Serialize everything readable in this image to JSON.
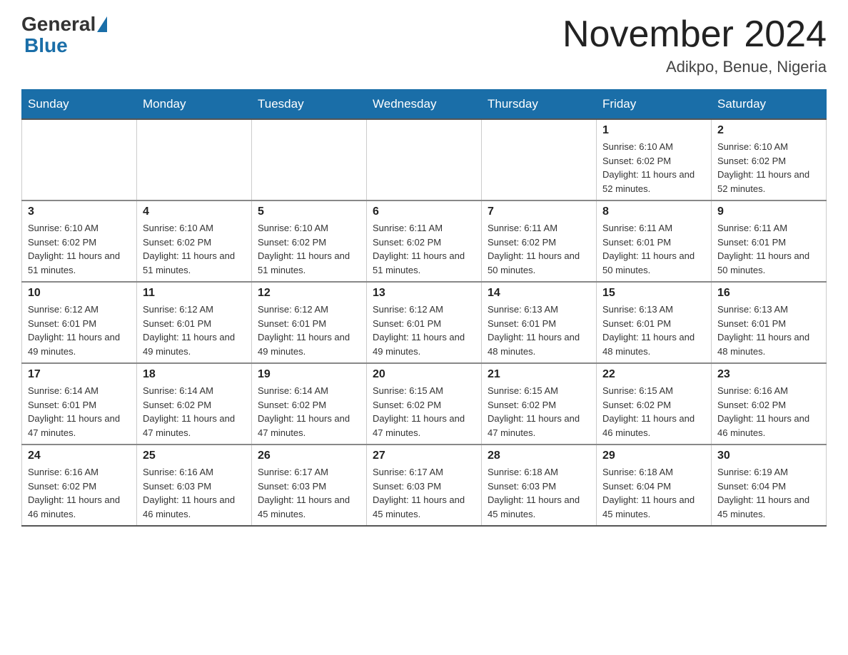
{
  "header": {
    "logo_general": "General",
    "logo_blue": "Blue",
    "title": "November 2024",
    "subtitle": "Adikpo, Benue, Nigeria"
  },
  "days_of_week": [
    "Sunday",
    "Monday",
    "Tuesday",
    "Wednesday",
    "Thursday",
    "Friday",
    "Saturday"
  ],
  "weeks": [
    [
      {
        "num": "",
        "sunrise": "",
        "sunset": "",
        "daylight": "",
        "empty": true
      },
      {
        "num": "",
        "sunrise": "",
        "sunset": "",
        "daylight": "",
        "empty": true
      },
      {
        "num": "",
        "sunrise": "",
        "sunset": "",
        "daylight": "",
        "empty": true
      },
      {
        "num": "",
        "sunrise": "",
        "sunset": "",
        "daylight": "",
        "empty": true
      },
      {
        "num": "",
        "sunrise": "",
        "sunset": "",
        "daylight": "",
        "empty": true
      },
      {
        "num": "1",
        "sunrise": "Sunrise: 6:10 AM",
        "sunset": "Sunset: 6:02 PM",
        "daylight": "Daylight: 11 hours and 52 minutes.",
        "empty": false
      },
      {
        "num": "2",
        "sunrise": "Sunrise: 6:10 AM",
        "sunset": "Sunset: 6:02 PM",
        "daylight": "Daylight: 11 hours and 52 minutes.",
        "empty": false
      }
    ],
    [
      {
        "num": "3",
        "sunrise": "Sunrise: 6:10 AM",
        "sunset": "Sunset: 6:02 PM",
        "daylight": "Daylight: 11 hours and 51 minutes.",
        "empty": false
      },
      {
        "num": "4",
        "sunrise": "Sunrise: 6:10 AM",
        "sunset": "Sunset: 6:02 PM",
        "daylight": "Daylight: 11 hours and 51 minutes.",
        "empty": false
      },
      {
        "num": "5",
        "sunrise": "Sunrise: 6:10 AM",
        "sunset": "Sunset: 6:02 PM",
        "daylight": "Daylight: 11 hours and 51 minutes.",
        "empty": false
      },
      {
        "num": "6",
        "sunrise": "Sunrise: 6:11 AM",
        "sunset": "Sunset: 6:02 PM",
        "daylight": "Daylight: 11 hours and 51 minutes.",
        "empty": false
      },
      {
        "num": "7",
        "sunrise": "Sunrise: 6:11 AM",
        "sunset": "Sunset: 6:02 PM",
        "daylight": "Daylight: 11 hours and 50 minutes.",
        "empty": false
      },
      {
        "num": "8",
        "sunrise": "Sunrise: 6:11 AM",
        "sunset": "Sunset: 6:01 PM",
        "daylight": "Daylight: 11 hours and 50 minutes.",
        "empty": false
      },
      {
        "num": "9",
        "sunrise": "Sunrise: 6:11 AM",
        "sunset": "Sunset: 6:01 PM",
        "daylight": "Daylight: 11 hours and 50 minutes.",
        "empty": false
      }
    ],
    [
      {
        "num": "10",
        "sunrise": "Sunrise: 6:12 AM",
        "sunset": "Sunset: 6:01 PM",
        "daylight": "Daylight: 11 hours and 49 minutes.",
        "empty": false
      },
      {
        "num": "11",
        "sunrise": "Sunrise: 6:12 AM",
        "sunset": "Sunset: 6:01 PM",
        "daylight": "Daylight: 11 hours and 49 minutes.",
        "empty": false
      },
      {
        "num": "12",
        "sunrise": "Sunrise: 6:12 AM",
        "sunset": "Sunset: 6:01 PM",
        "daylight": "Daylight: 11 hours and 49 minutes.",
        "empty": false
      },
      {
        "num": "13",
        "sunrise": "Sunrise: 6:12 AM",
        "sunset": "Sunset: 6:01 PM",
        "daylight": "Daylight: 11 hours and 49 minutes.",
        "empty": false
      },
      {
        "num": "14",
        "sunrise": "Sunrise: 6:13 AM",
        "sunset": "Sunset: 6:01 PM",
        "daylight": "Daylight: 11 hours and 48 minutes.",
        "empty": false
      },
      {
        "num": "15",
        "sunrise": "Sunrise: 6:13 AM",
        "sunset": "Sunset: 6:01 PM",
        "daylight": "Daylight: 11 hours and 48 minutes.",
        "empty": false
      },
      {
        "num": "16",
        "sunrise": "Sunrise: 6:13 AM",
        "sunset": "Sunset: 6:01 PM",
        "daylight": "Daylight: 11 hours and 48 minutes.",
        "empty": false
      }
    ],
    [
      {
        "num": "17",
        "sunrise": "Sunrise: 6:14 AM",
        "sunset": "Sunset: 6:01 PM",
        "daylight": "Daylight: 11 hours and 47 minutes.",
        "empty": false
      },
      {
        "num": "18",
        "sunrise": "Sunrise: 6:14 AM",
        "sunset": "Sunset: 6:02 PM",
        "daylight": "Daylight: 11 hours and 47 minutes.",
        "empty": false
      },
      {
        "num": "19",
        "sunrise": "Sunrise: 6:14 AM",
        "sunset": "Sunset: 6:02 PM",
        "daylight": "Daylight: 11 hours and 47 minutes.",
        "empty": false
      },
      {
        "num": "20",
        "sunrise": "Sunrise: 6:15 AM",
        "sunset": "Sunset: 6:02 PM",
        "daylight": "Daylight: 11 hours and 47 minutes.",
        "empty": false
      },
      {
        "num": "21",
        "sunrise": "Sunrise: 6:15 AM",
        "sunset": "Sunset: 6:02 PM",
        "daylight": "Daylight: 11 hours and 47 minutes.",
        "empty": false
      },
      {
        "num": "22",
        "sunrise": "Sunrise: 6:15 AM",
        "sunset": "Sunset: 6:02 PM",
        "daylight": "Daylight: 11 hours and 46 minutes.",
        "empty": false
      },
      {
        "num": "23",
        "sunrise": "Sunrise: 6:16 AM",
        "sunset": "Sunset: 6:02 PM",
        "daylight": "Daylight: 11 hours and 46 minutes.",
        "empty": false
      }
    ],
    [
      {
        "num": "24",
        "sunrise": "Sunrise: 6:16 AM",
        "sunset": "Sunset: 6:02 PM",
        "daylight": "Daylight: 11 hours and 46 minutes.",
        "empty": false
      },
      {
        "num": "25",
        "sunrise": "Sunrise: 6:16 AM",
        "sunset": "Sunset: 6:03 PM",
        "daylight": "Daylight: 11 hours and 46 minutes.",
        "empty": false
      },
      {
        "num": "26",
        "sunrise": "Sunrise: 6:17 AM",
        "sunset": "Sunset: 6:03 PM",
        "daylight": "Daylight: 11 hours and 45 minutes.",
        "empty": false
      },
      {
        "num": "27",
        "sunrise": "Sunrise: 6:17 AM",
        "sunset": "Sunset: 6:03 PM",
        "daylight": "Daylight: 11 hours and 45 minutes.",
        "empty": false
      },
      {
        "num": "28",
        "sunrise": "Sunrise: 6:18 AM",
        "sunset": "Sunset: 6:03 PM",
        "daylight": "Daylight: 11 hours and 45 minutes.",
        "empty": false
      },
      {
        "num": "29",
        "sunrise": "Sunrise: 6:18 AM",
        "sunset": "Sunset: 6:04 PM",
        "daylight": "Daylight: 11 hours and 45 minutes.",
        "empty": false
      },
      {
        "num": "30",
        "sunrise": "Sunrise: 6:19 AM",
        "sunset": "Sunset: 6:04 PM",
        "daylight": "Daylight: 11 hours and 45 minutes.",
        "empty": false
      }
    ]
  ]
}
